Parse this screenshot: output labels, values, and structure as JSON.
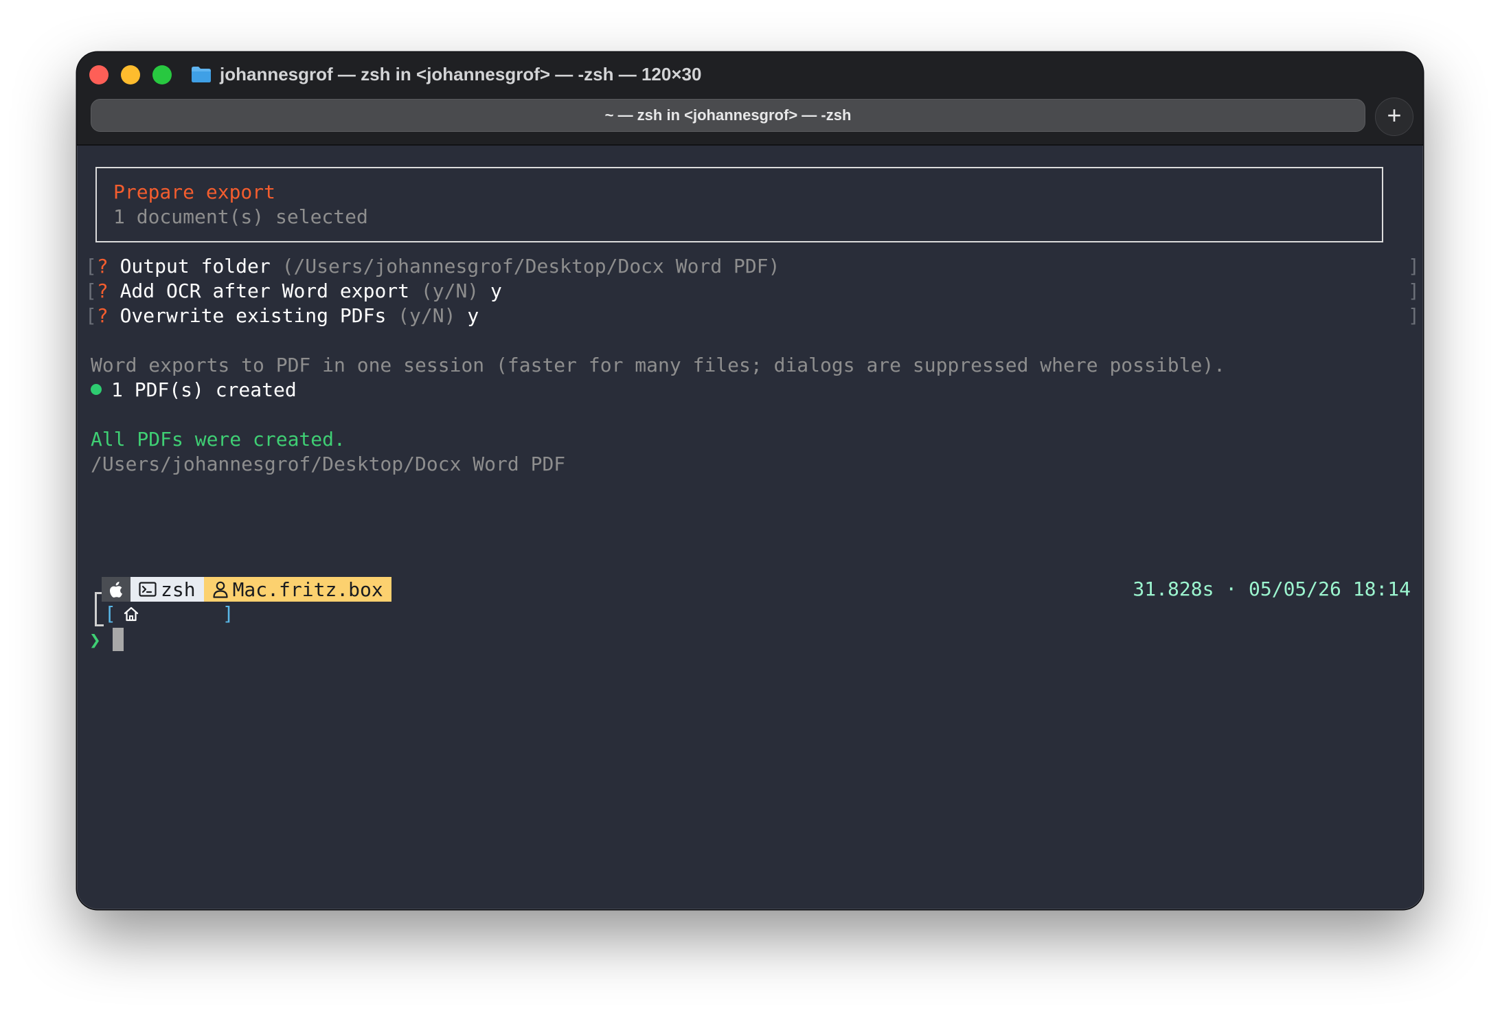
{
  "window": {
    "title": "johannesgrof — zsh in <johannesgrof> — -zsh — 120×30",
    "tab_label": "~ — zsh in <johannesgrof> — -zsh",
    "new_tab_label": "+"
  },
  "terminal": {
    "box": {
      "heading": "Prepare export",
      "subtext": "1 document(s) selected"
    },
    "prompts": [
      {
        "mark": "?",
        "question": "Output folder",
        "hint": "(/Users/johannesgrof/Desktop/Docx Word PDF)",
        "answer": ""
      },
      {
        "mark": "?",
        "question": "Add OCR after Word export",
        "hint": "(y/N)",
        "answer": "y"
      },
      {
        "mark": "?",
        "question": "Overwrite existing PDFs",
        "hint": "(y/N)",
        "answer": "y"
      }
    ],
    "open_bracket": "[",
    "close_bracket": "]",
    "info_line": "Word exports to PDF in one session (faster for many files; dialogs are suppressed where possible).",
    "status_line": "1 PDF(s) created",
    "success_line": "All PDFs were created.",
    "output_path": "/Users/johannesgrof/Desktop/Docx Word PDF",
    "prompt_bar": {
      "shell": "zsh",
      "host": "Mac.fritz.box",
      "duration_time": "31.828s · 05/05/26 18:14",
      "dir_open": "[",
      "dir_close": "]",
      "caret": "❯"
    }
  },
  "colors": {
    "background": "#292d39",
    "accent_orange": "#f45d2e",
    "success_green": "#3fcf74",
    "host_badge": "#fcd16f",
    "time_teal": "#9cf5cf"
  }
}
